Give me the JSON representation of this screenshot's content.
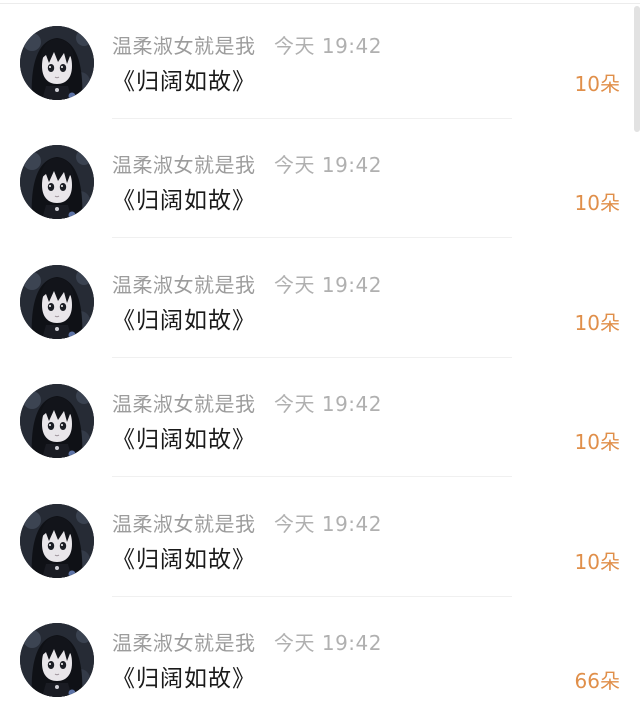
{
  "messages": [
    {
      "username": "温柔淑女就是我",
      "time": "今天 19:42",
      "text": "《归阔如故》",
      "gift": "10朵"
    },
    {
      "username": "温柔淑女就是我",
      "time": "今天 19:42",
      "text": "《归阔如故》",
      "gift": "10朵"
    },
    {
      "username": "温柔淑女就是我",
      "time": "今天 19:42",
      "text": "《归阔如故》",
      "gift": "10朵"
    },
    {
      "username": "温柔淑女就是我",
      "time": "今天 19:42",
      "text": "《归阔如故》",
      "gift": "10朵"
    },
    {
      "username": "温柔淑女就是我",
      "time": "今天 19:42",
      "text": "《归阔如故》",
      "gift": "10朵"
    },
    {
      "username": "温柔淑女就是我",
      "time": "今天 19:42",
      "text": "《归阔如故》",
      "gift": "66朵"
    }
  ],
  "colors": {
    "username": "#9c9c9c",
    "time": "#b0b0b0",
    "message": "#1a1a1a",
    "gift": "#e08f4a"
  },
  "avatar_icon": "anime-girl-avatar"
}
